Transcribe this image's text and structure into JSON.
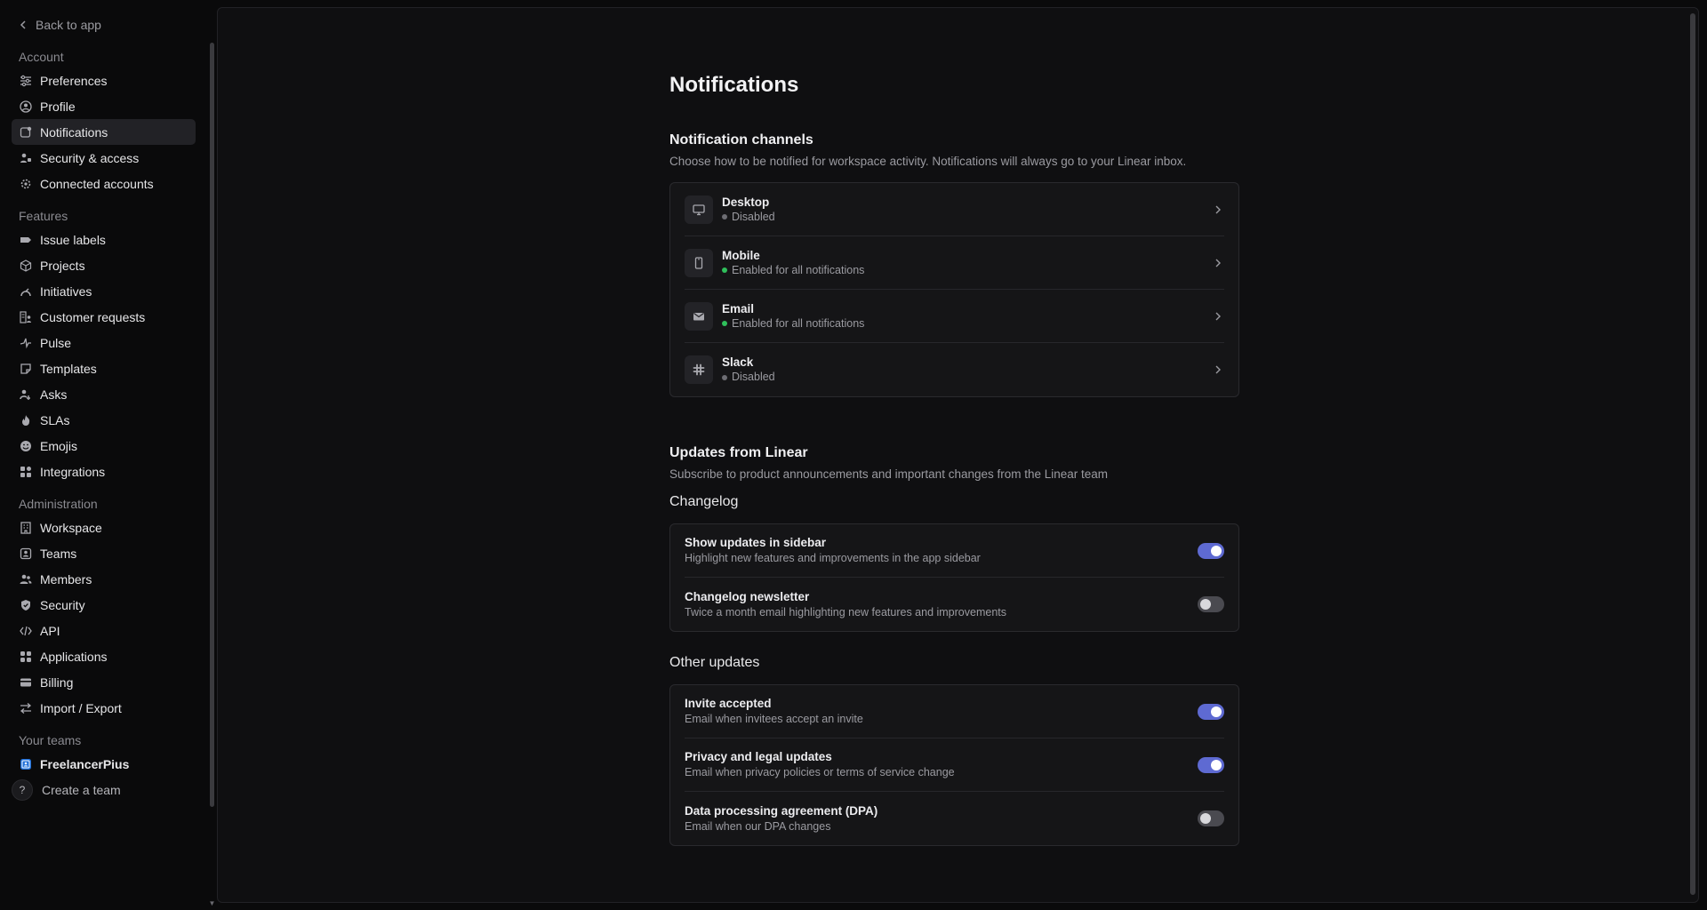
{
  "sidebar": {
    "back_label": "Back to app",
    "account": {
      "title": "Account",
      "items": [
        {
          "label": "Preferences",
          "icon": "sliders-icon"
        },
        {
          "label": "Profile",
          "icon": "user-circle-icon"
        },
        {
          "label": "Notifications",
          "icon": "notification-icon",
          "active": true
        },
        {
          "label": "Security & access",
          "icon": "user-lock-icon"
        },
        {
          "label": "Connected accounts",
          "icon": "gear-icon"
        }
      ]
    },
    "features": {
      "title": "Features",
      "items": [
        {
          "label": "Issue labels",
          "icon": "tag-icon"
        },
        {
          "label": "Projects",
          "icon": "cube-icon"
        },
        {
          "label": "Initiatives",
          "icon": "initiative-icon"
        },
        {
          "label": "Customer requests",
          "icon": "customer-icon"
        },
        {
          "label": "Pulse",
          "icon": "pulse-icon"
        },
        {
          "label": "Templates",
          "icon": "template-icon"
        },
        {
          "label": "Asks",
          "icon": "asks-icon"
        },
        {
          "label": "SLAs",
          "icon": "flame-icon"
        },
        {
          "label": "Emojis",
          "icon": "emoji-icon"
        },
        {
          "label": "Integrations",
          "icon": "grid-icon"
        }
      ]
    },
    "administration": {
      "title": "Administration",
      "items": [
        {
          "label": "Workspace",
          "icon": "building-icon"
        },
        {
          "label": "Teams",
          "icon": "team-icon"
        },
        {
          "label": "Members",
          "icon": "members-icon"
        },
        {
          "label": "Security",
          "icon": "shield-icon"
        },
        {
          "label": "API",
          "icon": "code-icon"
        },
        {
          "label": "Applications",
          "icon": "apps-icon"
        },
        {
          "label": "Billing",
          "icon": "card-icon"
        },
        {
          "label": "Import / Export",
          "icon": "arrows-icon"
        }
      ]
    },
    "teams": {
      "title": "Your teams",
      "team_name": "FreelancerPius",
      "create_label": "Create a team",
      "help_label": "?"
    }
  },
  "main": {
    "title": "Notifications",
    "channels": {
      "title": "Notification channels",
      "description": "Choose how to be notified for workspace activity. Notifications will always go to your Linear inbox.",
      "items": [
        {
          "name": "Desktop",
          "status": "Disabled",
          "enabled": false,
          "icon": "monitor-icon"
        },
        {
          "name": "Mobile",
          "status": "Enabled for all notifications",
          "enabled": true,
          "icon": "phone-icon"
        },
        {
          "name": "Email",
          "status": "Enabled for all notifications",
          "enabled": true,
          "icon": "mail-icon"
        },
        {
          "name": "Slack",
          "status": "Disabled",
          "enabled": false,
          "icon": "slack-icon"
        }
      ]
    },
    "updates": {
      "title": "Updates from Linear",
      "description": "Subscribe to product announcements and important changes from the Linear team",
      "changelog": {
        "title": "Changelog",
        "items": [
          {
            "title": "Show updates in sidebar",
            "desc": "Highlight new features and improvements in the app sidebar",
            "on": true
          },
          {
            "title": "Changelog newsletter",
            "desc": "Twice a month email highlighting new features and improvements",
            "on": false
          }
        ]
      },
      "other": {
        "title": "Other updates",
        "items": [
          {
            "title": "Invite accepted",
            "desc": "Email when invitees accept an invite",
            "on": true
          },
          {
            "title": "Privacy and legal updates",
            "desc": "Email when privacy policies or terms of service change",
            "on": true
          },
          {
            "title": "Data processing agreement (DPA)",
            "desc": "Email when our DPA changes",
            "on": false
          }
        ]
      }
    }
  },
  "colors": {
    "accent": "#5e6ad2",
    "enabled_dot": "#2fbf5b",
    "disabled_dot": "#6d6d73",
    "background": "#0a0a0b",
    "panel": "#0f0f11"
  }
}
